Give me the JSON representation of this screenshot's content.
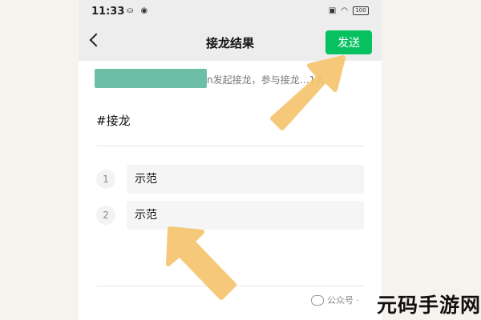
{
  "status": {
    "time": "11:33",
    "left_icons": [
      "notification-icon",
      "location-icon"
    ],
    "right_icons": [
      "vibrate-icon",
      "wifi-icon",
      "battery-icon"
    ],
    "battery_label": "100"
  },
  "nav": {
    "title": "接龙结果",
    "send_label": "发送"
  },
  "info": {
    "text": "n发起接龙，参与接龙…1人"
  },
  "topic": "#接龙",
  "entries": [
    {
      "index": "1",
      "text": "示范"
    },
    {
      "index": "2",
      "text": "示范"
    }
  ],
  "annotations": {
    "arrow_color": "#f6c46c"
  },
  "watermark": {
    "account_label": "公众号 ·",
    "site_name": "元码手游网"
  }
}
